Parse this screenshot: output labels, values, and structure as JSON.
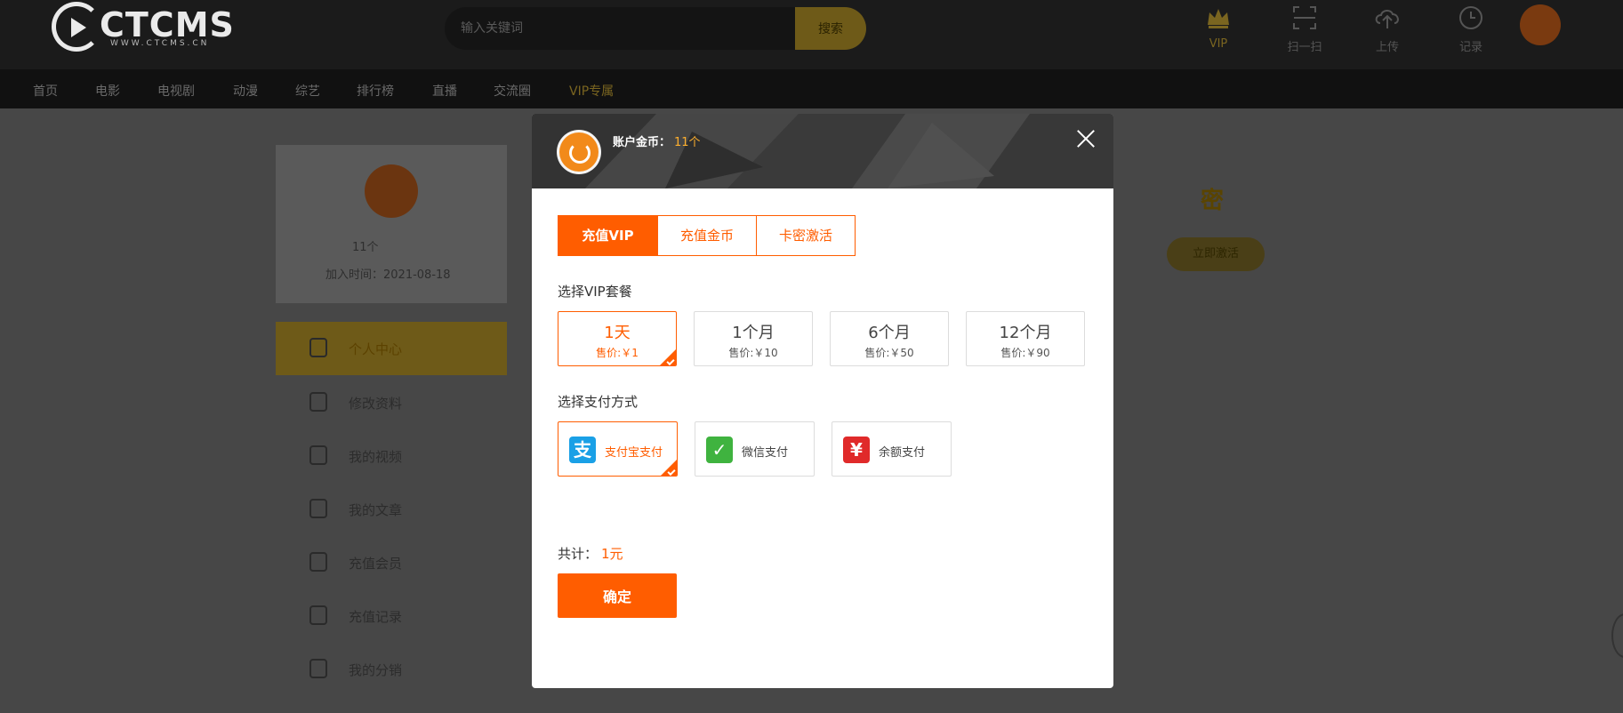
{
  "colors": {
    "accent": "#ff5d00",
    "coin": "#ffb02e",
    "gold_dim": "#6e5a18",
    "header_bg": "#1b1b1b"
  },
  "header": {
    "logo_text": "CTCMS",
    "logo_sub": "WWW.CTCMS.CN",
    "search_placeholder": "输入关键词",
    "search_button": "搜索",
    "tools": [
      {
        "label": "VIP",
        "icon": "crown-icon"
      },
      {
        "label": "扫一扫",
        "icon": "scan-icon"
      },
      {
        "label": "上传",
        "icon": "upload-icon"
      },
      {
        "label": "记录",
        "icon": "clock-icon"
      }
    ]
  },
  "nav": {
    "items": [
      "首页",
      "电影",
      "电视剧",
      "动漫",
      "综艺",
      "排行榜",
      "直播",
      "交流圈",
      "VIP专属"
    ]
  },
  "sidebar": {
    "coins": "11个",
    "join_date": "加入时间：2021-08-18",
    "items": [
      "个人中心",
      "修改资料",
      "我的视频",
      "我的文章",
      "充值会员",
      "充值记录",
      "我的分销"
    ]
  },
  "right_panel": {
    "mark": "密",
    "button": "立即激活"
  },
  "modal": {
    "coin_label": "账户金币：",
    "coin_value": "11个",
    "tabs": [
      "充值VIP",
      "充值金币",
      "卡密激活"
    ],
    "active_tab": 0,
    "plan_title": "选择VIP套餐",
    "plans": [
      {
        "name": "1天",
        "price": "售价:￥1",
        "selected": true
      },
      {
        "name": "1个月",
        "price": "售价:￥10",
        "selected": false
      },
      {
        "name": "6个月",
        "price": "售价:￥50",
        "selected": false
      },
      {
        "name": "12个月",
        "price": "售价:￥90",
        "selected": false
      }
    ],
    "pay_title": "选择支付方式",
    "payments": [
      {
        "label": "支付宝支付",
        "icon": "alipay-icon",
        "glyph": "支",
        "color": "#1aa0e6",
        "selected": true
      },
      {
        "label": "微信支付",
        "icon": "wechat-icon",
        "glyph": "✓",
        "color": "#3fb33f",
        "selected": false
      },
      {
        "label": "余额支付",
        "icon": "balance-icon",
        "glyph": "¥",
        "color": "#e02a2a",
        "selected": false
      }
    ],
    "total_label": "共计：",
    "total_value": "1元",
    "confirm": "确定"
  }
}
